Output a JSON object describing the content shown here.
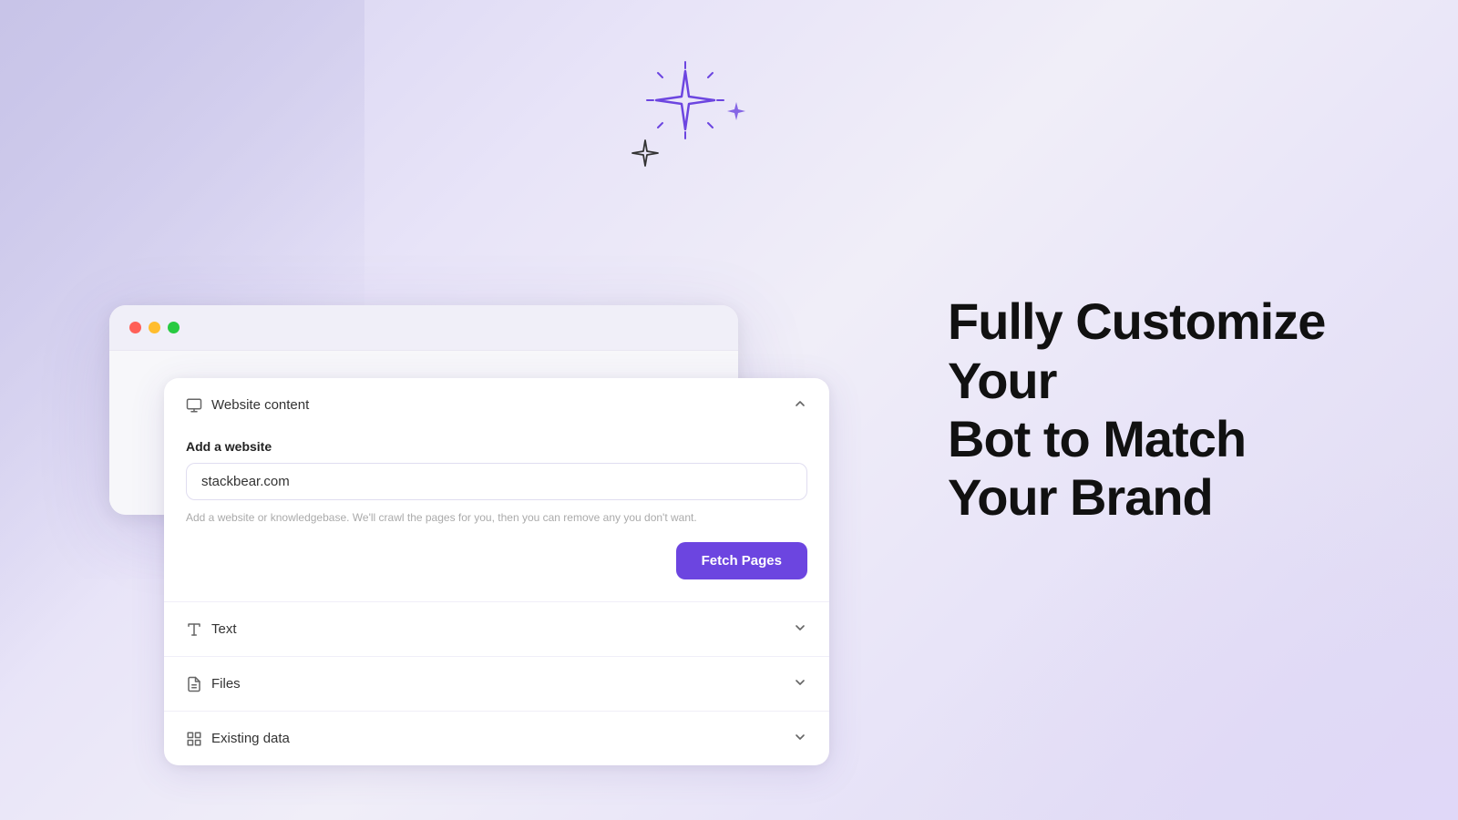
{
  "page": {
    "background": "gradient"
  },
  "browser": {
    "traffic_lights": [
      "red",
      "yellow",
      "green"
    ]
  },
  "card": {
    "sections": [
      {
        "id": "website",
        "label": "Website content",
        "expanded": true,
        "icon": "monitor-icon"
      },
      {
        "id": "text",
        "label": "Text",
        "expanded": false,
        "icon": "text-icon"
      },
      {
        "id": "files",
        "label": "Files",
        "expanded": false,
        "icon": "file-icon"
      },
      {
        "id": "existing-data",
        "label": "Existing data",
        "expanded": false,
        "icon": "grid-icon"
      }
    ],
    "website_form": {
      "label": "Add a website",
      "input_value": "stackbear.com",
      "helper_text": "Add a website or knowledgebase. We'll crawl the pages for you, then you can remove any you don't want.",
      "button_label": "Fetch Pages"
    }
  },
  "hero": {
    "title_line1": "Fully Customize Your",
    "title_line2": "Bot to Match Your Brand"
  }
}
